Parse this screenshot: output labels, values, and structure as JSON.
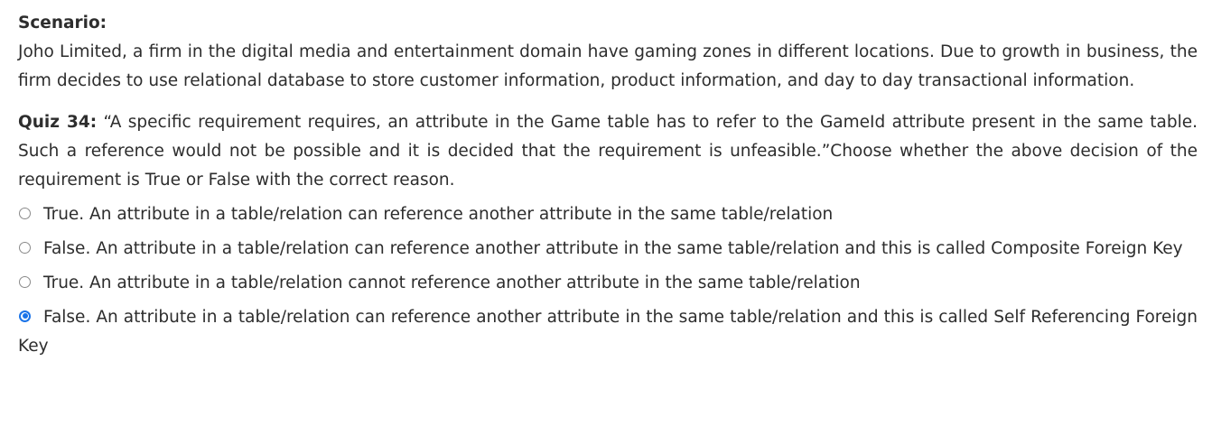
{
  "scenario": {
    "title": "Scenario:",
    "text": "Joho Limited, a firm in the digital media and entertainment domain have gaming zones in different locations. Due to growth in business, the firm decides to use relational database to store customer information, product information, and day to day transactional information."
  },
  "quiz": {
    "label": "Quiz 34:",
    "question": "“A specific requirement requires, an attribute in the Game table has to refer to the GameId attribute present in the same table. Such a reference would not be possible and it is decided that the requirement is unfeasible.”Choose whether the above decision of the requirement is True or False with the correct reason."
  },
  "options": [
    {
      "text": "True. An attribute in a table/relation can reference another attribute in the same table/relation",
      "selected": false
    },
    {
      "text": "False. An attribute in a table/relation can reference another attribute in the same table/relation and this is called Composite Foreign Key",
      "selected": false
    },
    {
      "text": "True. An attribute in a table/relation cannot reference another attribute in the same table/relation",
      "selected": false
    },
    {
      "text": "False. An attribute in a table/relation can reference another attribute in the same table/relation and this is called Self Referencing Foreign Key",
      "selected": true
    }
  ],
  "colors": {
    "accent": "#1a73e8",
    "text": "#2d2d2d"
  }
}
